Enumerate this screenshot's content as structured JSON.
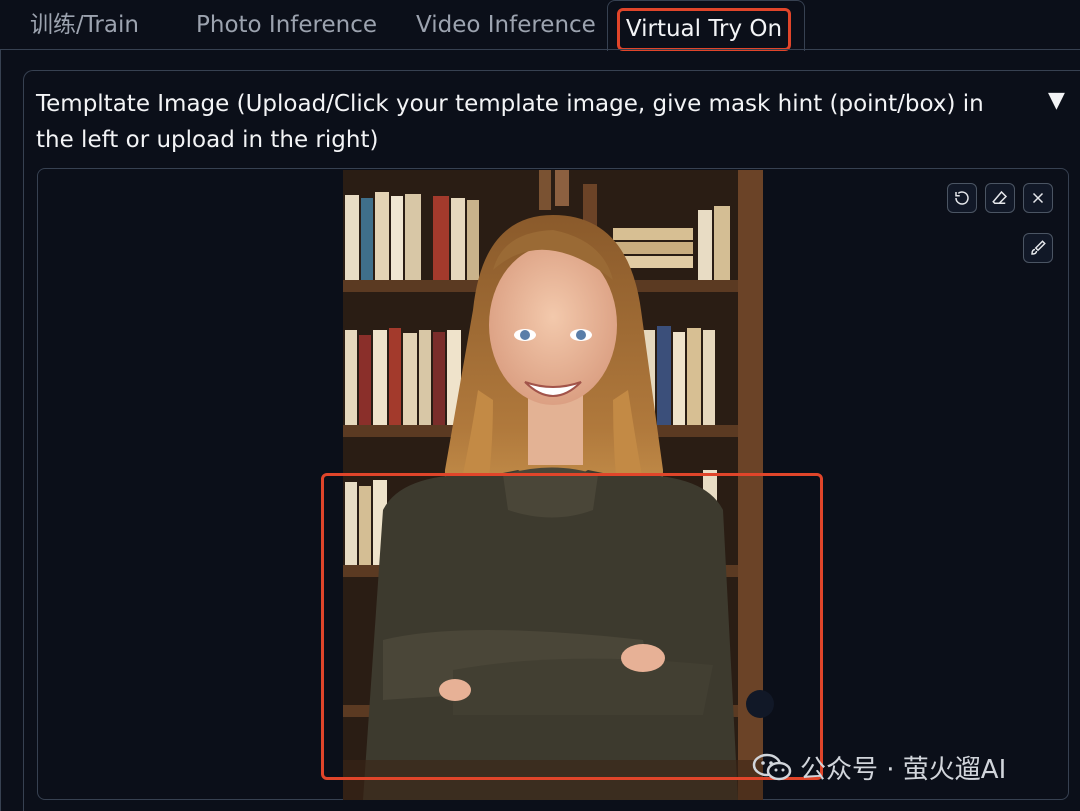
{
  "tabs": [
    {
      "label": "训练/Train",
      "active": false
    },
    {
      "label": "Photo Inference",
      "active": false
    },
    {
      "label": "Video Inference",
      "active": false
    },
    {
      "label": "Virtual Try On",
      "active": true
    }
  ],
  "section": {
    "title": "Templtate Image (Upload/Click your template image, give mask hint (point/box) in the left or upload in the right)",
    "collapse_symbol": "▼"
  },
  "image_toolbar": {
    "icons": [
      "undo-icon",
      "eraser-icon",
      "close-icon",
      "brush-icon"
    ]
  },
  "watermark": {
    "text": "公众号 · 萤火遛AI",
    "icon": "wechat-icon"
  },
  "colors": {
    "background": "#0b0f19",
    "border": "#374151",
    "highlight": "#e0452a"
  }
}
